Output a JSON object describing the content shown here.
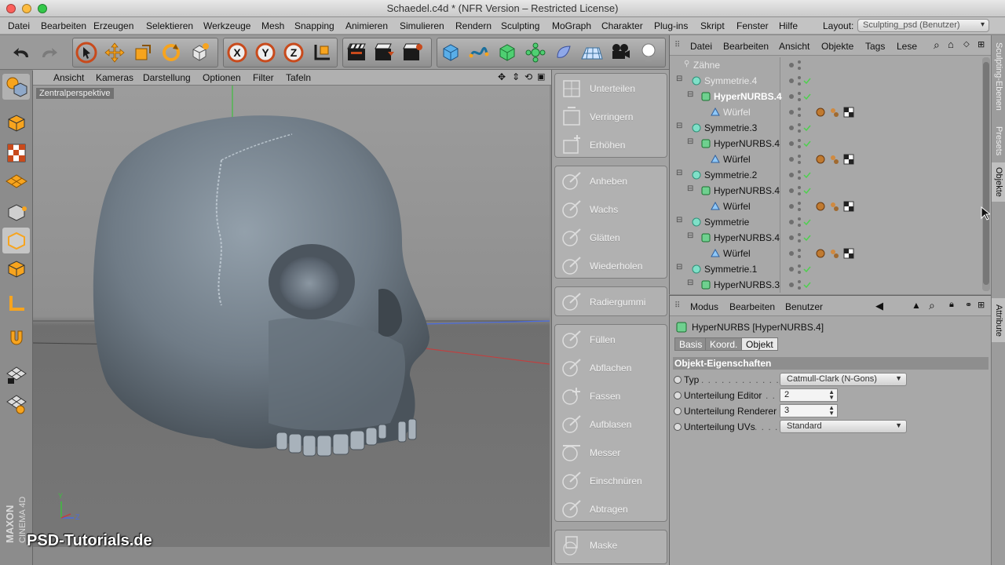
{
  "window": {
    "title": "Schaedel.c4d * (NFR Version – Restricted License)"
  },
  "menubar": {
    "items": [
      "Datei",
      "Bearbeiten",
      "Erzeugen",
      "Selektieren",
      "Werkzeuge",
      "Mesh",
      "Snapping",
      "Animieren",
      "Simulieren",
      "Rendern",
      "Sculpting",
      "MoGraph",
      "Charakter",
      "Plug-ins",
      "Skript",
      "Fenster",
      "Hilfe"
    ],
    "layout_label": "Layout:",
    "layout_value": "Sculpting_psd (Benutzer)"
  },
  "viewport": {
    "menu": [
      "Ansicht",
      "Kameras",
      "Darstellung",
      "Optionen",
      "Filter",
      "Tafeln"
    ],
    "camera_label": "Zentralperspektive",
    "axis_y": "Y",
    "axis_z": "Z"
  },
  "watermark": "PSD-Tutorials.de",
  "branding": {
    "maxon": "MAXON",
    "cinema": "CINEMA 4D"
  },
  "sculpt_tools": [
    {
      "label": "Unterteilen"
    },
    {
      "label": "Verringern"
    },
    {
      "label": "Erhöhen"
    },
    {
      "label": "Anheben"
    },
    {
      "label": "Wachs"
    },
    {
      "label": "Glätten"
    },
    {
      "label": "Wiederholen"
    },
    {
      "label": "Radiergummi"
    },
    {
      "label": "Füllen"
    },
    {
      "label": "Abflachen"
    },
    {
      "label": "Fassen"
    },
    {
      "label": "Aufblasen"
    },
    {
      "label": "Messer"
    },
    {
      "label": "Einschnüren"
    },
    {
      "label": "Abtragen"
    },
    {
      "label": "Maske"
    }
  ],
  "object_manager": {
    "menu": [
      "Datei",
      "Bearbeiten",
      "Ansicht",
      "Objekte",
      "Tags",
      "Lese"
    ],
    "rows": [
      {
        "name": "Zähne",
        "dim": true
      },
      {
        "name": "Symmetrie.4",
        "dim": true
      },
      {
        "name": "HyperNURBS.4",
        "selected": true
      },
      {
        "name": "Würfel",
        "dim": true
      },
      {
        "name": "Symmetrie.3"
      },
      {
        "name": "HyperNURBS.4"
      },
      {
        "name": "Würfel"
      },
      {
        "name": "Symmetrie.2"
      },
      {
        "name": "HyperNURBS.4"
      },
      {
        "name": "Würfel"
      },
      {
        "name": "Symmetrie"
      },
      {
        "name": "HyperNURBS.4"
      },
      {
        "name": "Würfel"
      },
      {
        "name": "Symmetrie.1"
      },
      {
        "name": "HyperNURBS.3"
      }
    ]
  },
  "attribute_manager": {
    "menu": [
      "Modus",
      "Bearbeiten",
      "Benutzer"
    ],
    "object_title": "HyperNURBS [HyperNURBS.4]",
    "tabs": [
      "Basis",
      "Koord.",
      "Objekt"
    ],
    "section": "Objekt-Eigenschaften",
    "fields": [
      {
        "label": "Typ",
        "dots": ". . . . . . . . . . . . . . .",
        "value": "Catmull-Clark (N-Gons)"
      },
      {
        "label": "Unterteilung Editor",
        "dots": ". .",
        "value": "2"
      },
      {
        "label": "Unterteilung Renderer",
        "dots": "",
        "value": "3"
      },
      {
        "label": "Unterteilung UVs",
        "dots": ". . . . .",
        "value": "Standard"
      }
    ]
  },
  "side_tabs": [
    "Sculpting-Ebenen",
    "Presets",
    "Objekte",
    "Attribute"
  ],
  "colors": {
    "accent_cyan": "#7fe0c8",
    "selected_text": "#ffffff",
    "check_green": "#4fd04f"
  }
}
